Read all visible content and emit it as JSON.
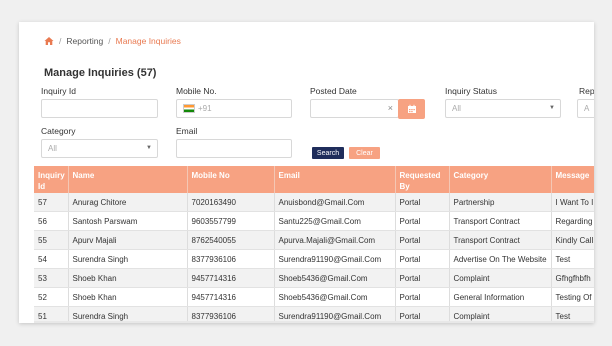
{
  "breadcrumb": {
    "home_icon": "home-icon",
    "items": [
      "Reporting",
      "Manage Inquiries"
    ]
  },
  "page_title": "Manage Inquiries (57)",
  "filters": {
    "inquiry_id": {
      "label": "Inquiry Id",
      "value": "",
      "placeholder": ""
    },
    "mobile": {
      "label": "Mobile No.",
      "value": "",
      "placeholder": "+91",
      "flag": "india-flag-icon"
    },
    "posted_date": {
      "label": "Posted Date",
      "value": "",
      "clear": "×"
    },
    "inquiry_status": {
      "label": "Inquiry Status",
      "value": "All"
    },
    "rep": {
      "label": "Rep",
      "value": "A"
    },
    "category": {
      "label": "Category",
      "value": "All"
    },
    "email": {
      "label": "Email",
      "value": ""
    }
  },
  "buttons": {
    "search": "Search",
    "clear": "Clear"
  },
  "colors": {
    "accent": "#f7a282",
    "accent_text": "#e97a51",
    "search_btn": "#1f2d5b"
  },
  "table": {
    "columns": [
      "Inquiry Id",
      "Name",
      "Mobile No",
      "Email",
      "Requested By",
      "Category",
      "Message"
    ],
    "rows": [
      [
        "57",
        "Anurag Chitore",
        "7020163490",
        "Anuisbond@Gmail.Com",
        "Portal",
        "Partnership",
        "I Want To I"
      ],
      [
        "56",
        "Santosh Parswam",
        "9603557799",
        "Santu225@Gmail.Com",
        "Portal",
        "Transport Contract",
        "Regarding"
      ],
      [
        "55",
        "Apurv Majali",
        "8762540055",
        "Apurva.Majali@Gmail.Com",
        "Portal",
        "Transport Contract",
        "Kindly Call"
      ],
      [
        "54",
        "Surendra Singh",
        "8377936106",
        "Surendra91190@Gmail.Com",
        "Portal",
        "Advertise On The Website",
        "Test"
      ],
      [
        "53",
        "Shoeb Khan",
        "9457714316",
        "Shoeb5436@Gmail.Com",
        "Portal",
        "Complaint",
        "Gfhgfhbfh"
      ],
      [
        "52",
        "Shoeb Khan",
        "9457714316",
        "Shoeb5436@Gmail.Com",
        "Portal",
        "General Information",
        "Testing Of"
      ],
      [
        "51",
        "Surendra Singh",
        "8377936106",
        "Surendra91190@Gmail.Com",
        "Portal",
        "Complaint",
        "Test"
      ]
    ]
  }
}
